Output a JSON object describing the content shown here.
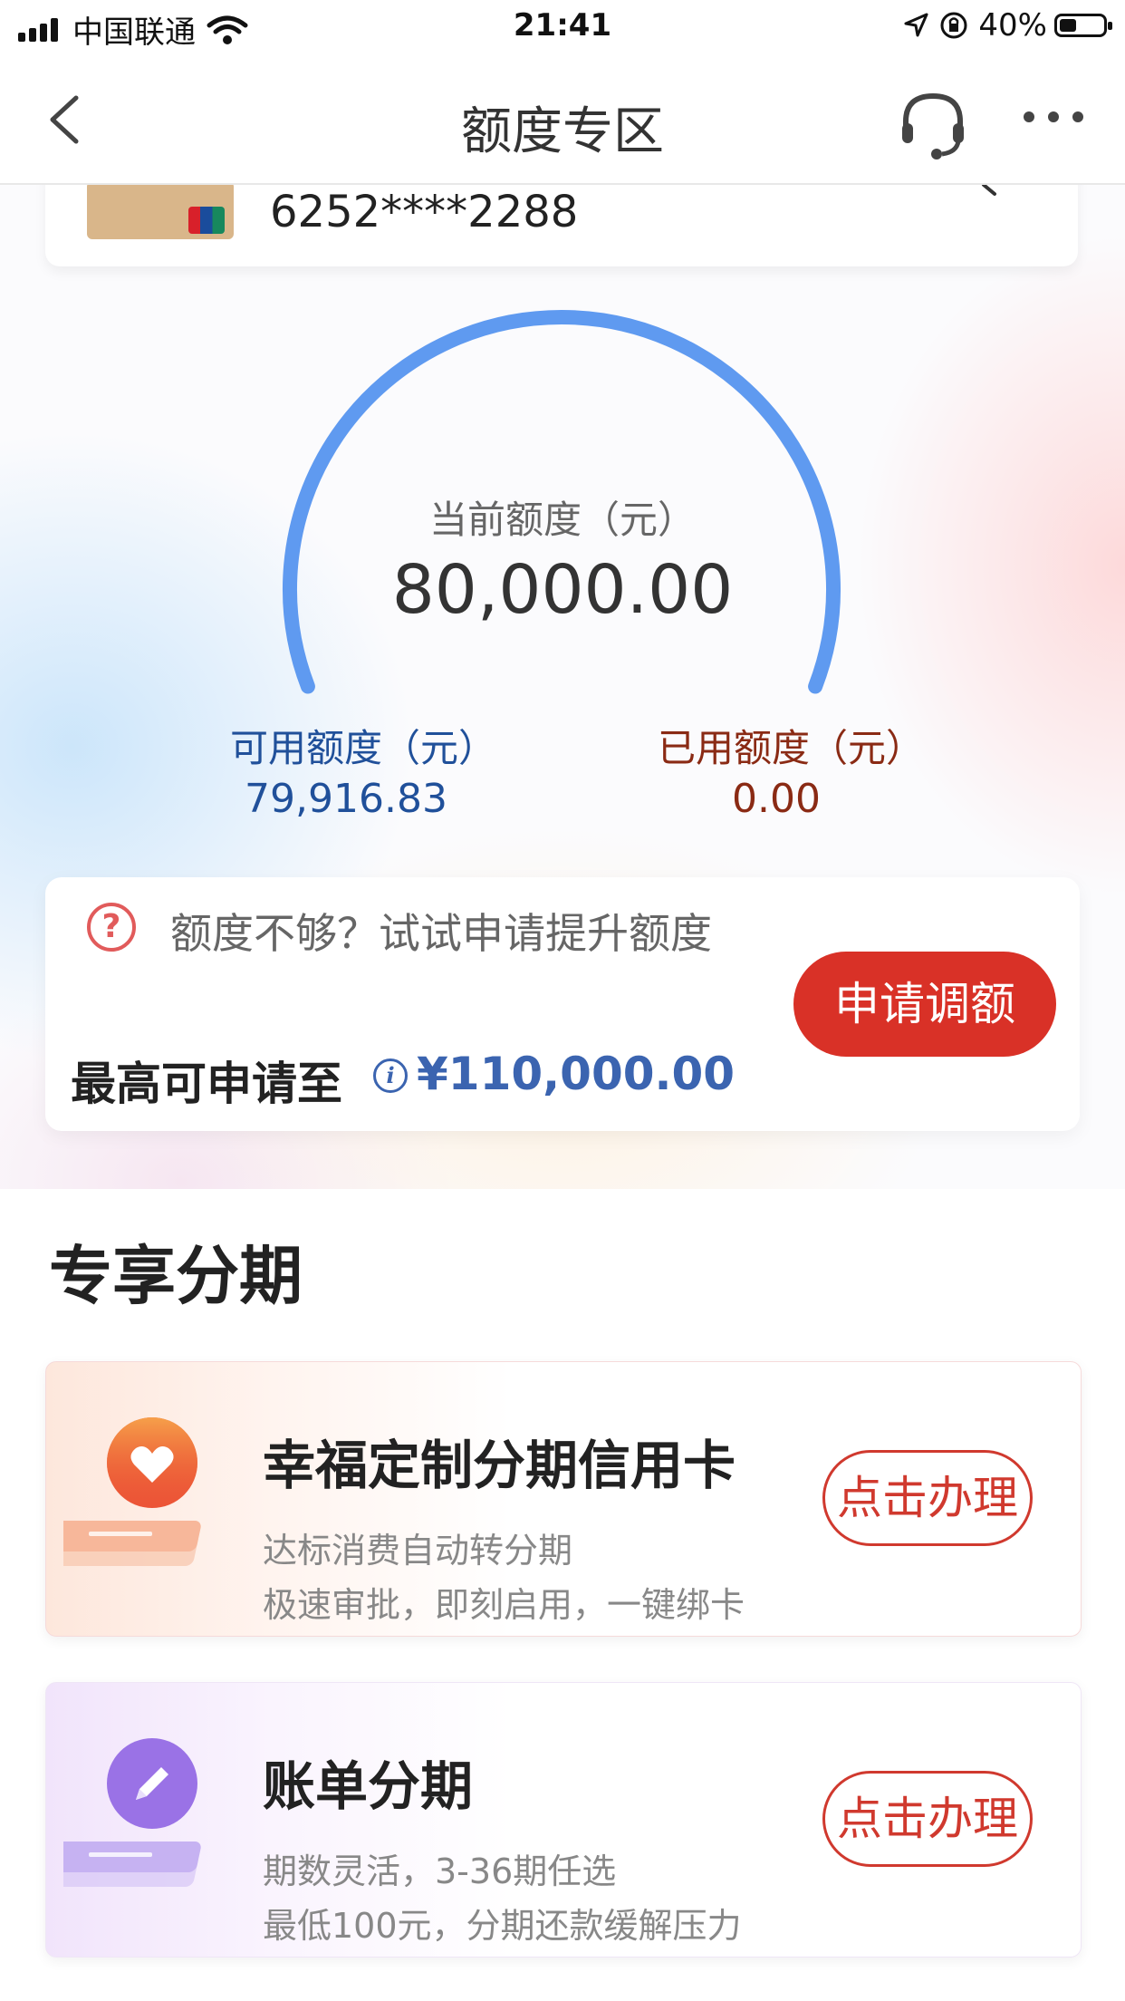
{
  "status_bar": {
    "carrier": "中国联通",
    "time": "21:41",
    "battery": "40%",
    "battery_level": 0.4
  },
  "nav": {
    "title": "额度专区",
    "icons": [
      "back-arrow-icon",
      "headset-icon",
      "more-dots-icon"
    ]
  },
  "card": {
    "number": "6252****2288"
  },
  "limit": {
    "current_label": "当前额度（元）",
    "current_value": "80,000.00",
    "available_label": "可用额度（元）",
    "available_value": "79,916.83",
    "used_label": "已用额度（元）",
    "used_value": "0.00",
    "gauge_color": "#5f9af0"
  },
  "raise": {
    "prompt": "额度不够？试试申请提升额度",
    "max_label": "最高可申请至",
    "max_value": "¥110,000.00",
    "button": "申请调额",
    "button_color": "#d93127"
  },
  "section": {
    "title": "专享分期"
  },
  "promos": [
    {
      "title": "幸福定制分期信用卡",
      "line1": "达标消费自动转分期",
      "line2": "极速审批，即刻启用，一键绑卡",
      "button": "点击办理",
      "icon": "heart-icon",
      "accent": "#ef6b3f"
    },
    {
      "title": "账单分期",
      "line1": "期数灵活，3-36期任选",
      "line2": "最低100元，分期还款缓解压力",
      "button": "点击办理",
      "icon": "pencil-icon",
      "accent": "#9f7ae8"
    }
  ]
}
